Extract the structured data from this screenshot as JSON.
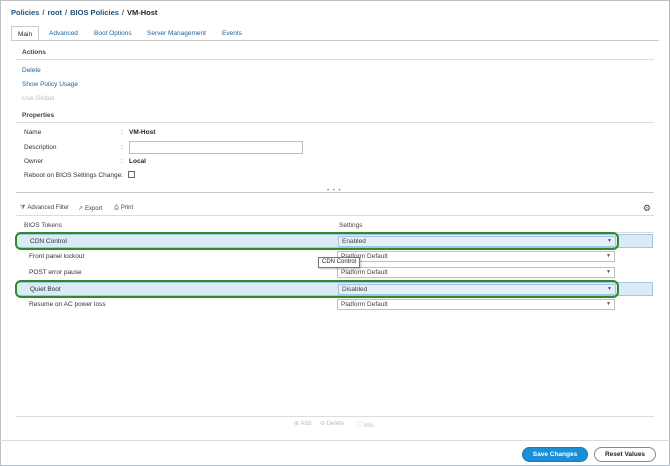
{
  "breadcrumb": {
    "items": [
      "Policies",
      "root",
      "BIOS Policies"
    ],
    "current": "VM-Host",
    "separator": "/"
  },
  "tabs": [
    {
      "label": "Main",
      "active": true
    },
    {
      "label": "Advanced"
    },
    {
      "label": "Boot Options"
    },
    {
      "label": "Server Management"
    },
    {
      "label": "Events"
    }
  ],
  "actions": {
    "heading": "Actions",
    "delete": "Delete",
    "show_usage": "Show Policy Usage",
    "use_global": "Use Global"
  },
  "properties": {
    "heading": "Properties",
    "name_label": "Name",
    "name_value": "VM-Host",
    "description_label": "Description",
    "description_value": "",
    "owner_label": "Owner",
    "owner_value": "Local",
    "reboot_label": "Reboot on BIOS Settings Change",
    "colon": ":"
  },
  "toolbar": {
    "advanced_filter": "Advanced Filter",
    "export": "Export",
    "print": "Print"
  },
  "table": {
    "headers": [
      "BIOS Tokens",
      "Settings"
    ],
    "rows": [
      {
        "token": "CDN Control",
        "setting": "Enabled"
      },
      {
        "token": "Front panel lockout",
        "setting": "Platform Default"
      },
      {
        "token": "POST error pause",
        "setting": "Platform Default"
      },
      {
        "token": "Quiet Boot",
        "setting": "Disabled"
      },
      {
        "token": "Resume on AC power loss",
        "setting": "Platform Default"
      }
    ]
  },
  "tooltip": "CDN Control",
  "list_actions": {
    "add": "Add",
    "delete": "Delete",
    "info": "Info"
  },
  "buttons": {
    "save": "Save Changes",
    "reset": "Reset Values"
  },
  "colors": {
    "highlight": "#2d8a2d",
    "primary_button": "#1a8fd5",
    "link": "#1f5f9b",
    "selected_row": "#d9ebf7"
  }
}
